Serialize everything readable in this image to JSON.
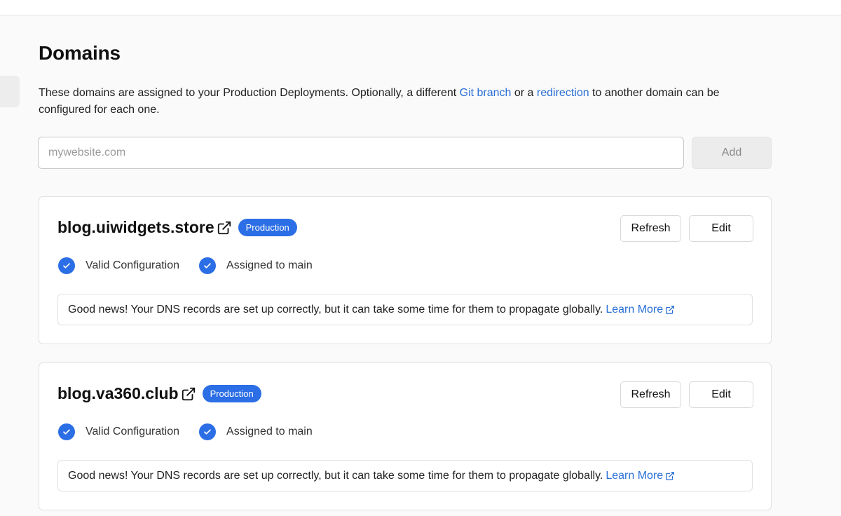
{
  "page": {
    "title": "Domains",
    "description_prefix": "These domains are assigned to your Production Deployments. Optionally, a different ",
    "git_branch_link": "Git branch",
    "description_middle": " or a ",
    "redirection_link": "redirection",
    "description_suffix": " to another domain can be configured for each one."
  },
  "add_domain": {
    "placeholder": "mywebsite.com",
    "value": "",
    "add_label": "Add"
  },
  "domains": [
    {
      "name": "blog.uiwidgets.store",
      "badge": "Production",
      "refresh_label": "Refresh",
      "edit_label": "Edit",
      "status_config": "Valid Configuration",
      "status_assigned": "Assigned to main",
      "notice": "Good news! Your DNS records are set up correctly, but it can take some time for them to propagate globally.",
      "learn_more": "Learn More"
    },
    {
      "name": "blog.va360.club",
      "badge": "Production",
      "refresh_label": "Refresh",
      "edit_label": "Edit",
      "status_config": "Valid Configuration",
      "status_assigned": "Assigned to main",
      "notice": "Good news! Your DNS records are set up correctly, but it can take some time for them to propagate globally.",
      "learn_more": "Learn More"
    }
  ],
  "icons": {
    "external_link": "external-link-icon",
    "check": "check-circle-icon"
  },
  "colors": {
    "accent": "#2b6ee6",
    "link": "#2a6fd6"
  }
}
